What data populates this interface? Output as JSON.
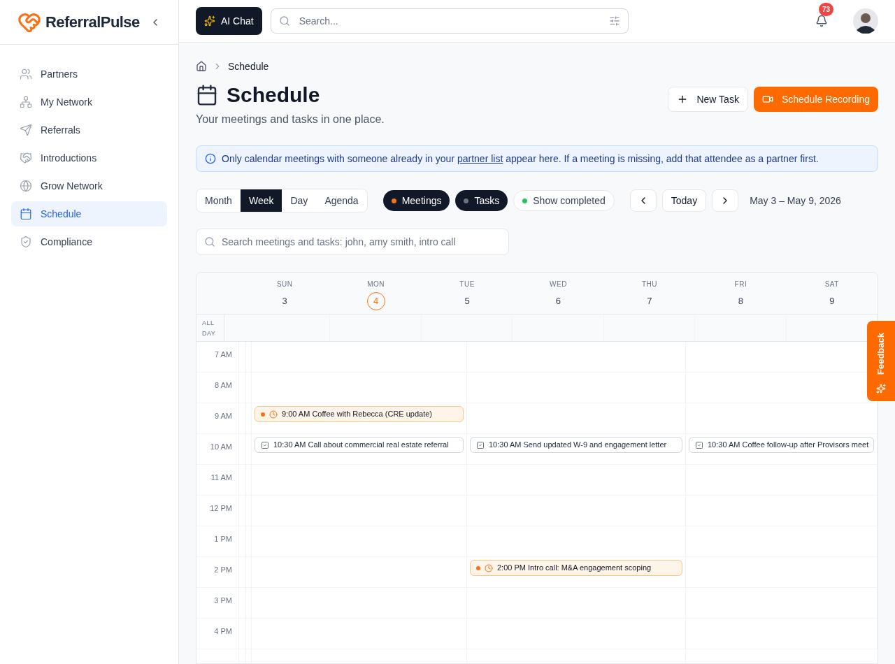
{
  "brand": {
    "name": "ReferralPulse"
  },
  "sidebar": {
    "items": [
      {
        "label": "Partners",
        "selected": false
      },
      {
        "label": "My Network",
        "selected": false
      },
      {
        "label": "Referrals",
        "selected": false
      },
      {
        "label": "Introductions",
        "selected": false
      },
      {
        "label": "Grow Network",
        "selected": false
      },
      {
        "label": "Schedule",
        "selected": true
      },
      {
        "label": "Compliance",
        "selected": false
      }
    ]
  },
  "topbar": {
    "ai_chat": "AI Chat",
    "search": {
      "placeholder": "Search..."
    },
    "notifications": "73"
  },
  "breadcrumb": [
    "Schedule"
  ],
  "page": {
    "title": "Schedule",
    "subtitle": "Your meetings and tasks in one place.",
    "actions": [
      {
        "label": "New Task",
        "kind": "secondary"
      },
      {
        "label": "Schedule Recording",
        "kind": "primary"
      }
    ]
  },
  "notice": {
    "before": "Only calendar meetings with someone already in your ",
    "link": "partner list",
    "after": " appear here. If a meeting is missing, add that attendee as a partner first."
  },
  "views": [
    {
      "label": "Month",
      "selected": false
    },
    {
      "label": "Week",
      "selected": true
    },
    {
      "label": "Day",
      "selected": false
    },
    {
      "label": "Agenda",
      "selected": false
    }
  ],
  "filters": [
    {
      "label": "Meetings",
      "on": true,
      "color": "#f97316"
    },
    {
      "label": "Tasks",
      "on": true,
      "color": "#6b7280"
    },
    {
      "label": "Show completed",
      "on": false,
      "color": "#22c55e"
    }
  ],
  "today": "Today",
  "range": "May 3 – May 9, 2026",
  "calendar_search": {
    "placeholder": "Search meetings and tasks: john, amy smith, intro call"
  },
  "calendar": {
    "days": [
      {
        "weekday": "SUN",
        "date": "3",
        "selected": false
      },
      {
        "weekday": "MON",
        "date": "4",
        "selected": true
      },
      {
        "weekday": "TUE",
        "date": "5",
        "selected": false
      },
      {
        "weekday": "WED",
        "date": "6",
        "selected": false
      },
      {
        "weekday": "THU",
        "date": "7",
        "selected": false
      },
      {
        "weekday": "FRI",
        "date": "8",
        "selected": false
      },
      {
        "weekday": "SAT",
        "date": "9",
        "selected": false
      }
    ],
    "all_day": "ALL DAY",
    "hours": [
      {
        "label": "7 AM",
        "cells": [
          {},
          {},
          {},
          {},
          {}
        ]
      },
      {
        "label": "8 AM",
        "cells": [
          {},
          {},
          {},
          {},
          {}
        ]
      },
      {
        "label": "9 AM",
        "cells": [
          {},
          {},
          {
            "events": [
              {
                "kind": "meeting",
                "text": "9:00 AM Coffee with Rebecca (CRE update)"
              }
            ]
          },
          {},
          {}
        ]
      },
      {
        "label": "10 AM",
        "cells": [
          {},
          {},
          {
            "events": [
              {
                "kind": "task",
                "text": "10:30 AM Call about commercial real estate referral"
              }
            ]
          },
          {
            "events": [
              {
                "kind": "task",
                "text": "10:30 AM Send updated W-9 and engagement letter"
              }
            ]
          },
          {
            "events": [
              {
                "kind": "task",
                "text": "10:30 AM Coffee follow-up after Provisors meet"
              }
            ]
          }
        ]
      },
      {
        "label": "11 AM",
        "cells": [
          {},
          {},
          {},
          {},
          {}
        ]
      },
      {
        "label": "12 PM",
        "cells": [
          {},
          {},
          {},
          {},
          {}
        ]
      },
      {
        "label": "1 PM",
        "cells": [
          {},
          {},
          {},
          {},
          {}
        ]
      },
      {
        "label": "2 PM",
        "cells": [
          {},
          {},
          {},
          {
            "events": [
              {
                "kind": "meeting",
                "text": "2:00 PM Intro call: M&A engagement scoping"
              }
            ]
          },
          {}
        ]
      },
      {
        "label": "3 PM",
        "cells": [
          {},
          {},
          {},
          {},
          {}
        ]
      },
      {
        "label": "4 PM",
        "cells": [
          {},
          {},
          {},
          {},
          {}
        ]
      }
    ]
  },
  "feedback": "Feedback"
}
